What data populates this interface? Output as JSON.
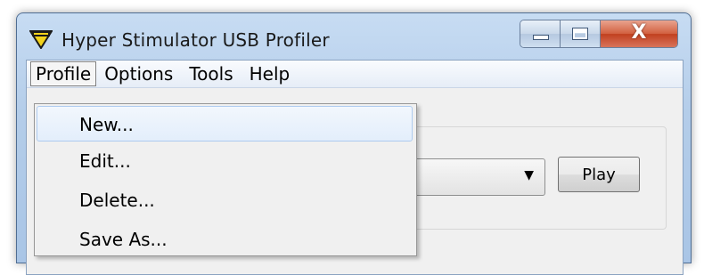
{
  "window": {
    "title": "Hyper Stimulator USB Profiler",
    "close_glyph": "X",
    "icon": "yellow-triangle-badge-icon"
  },
  "menubar": {
    "items": [
      {
        "label": "Profile",
        "open": true
      },
      {
        "label": "Options"
      },
      {
        "label": "Tools"
      },
      {
        "label": "Help"
      }
    ]
  },
  "profile_menu": {
    "items": [
      {
        "label": "New...",
        "highlighted": true
      },
      {
        "label": "Edit..."
      },
      {
        "label": "Delete..."
      },
      {
        "label": "Save As..."
      }
    ]
  },
  "main": {
    "play_label": "Play",
    "combo_value": ""
  },
  "colors": {
    "title_bar": "#b4cde9",
    "close_button": "#c1401f",
    "menu_highlight": "#e3eefb"
  }
}
